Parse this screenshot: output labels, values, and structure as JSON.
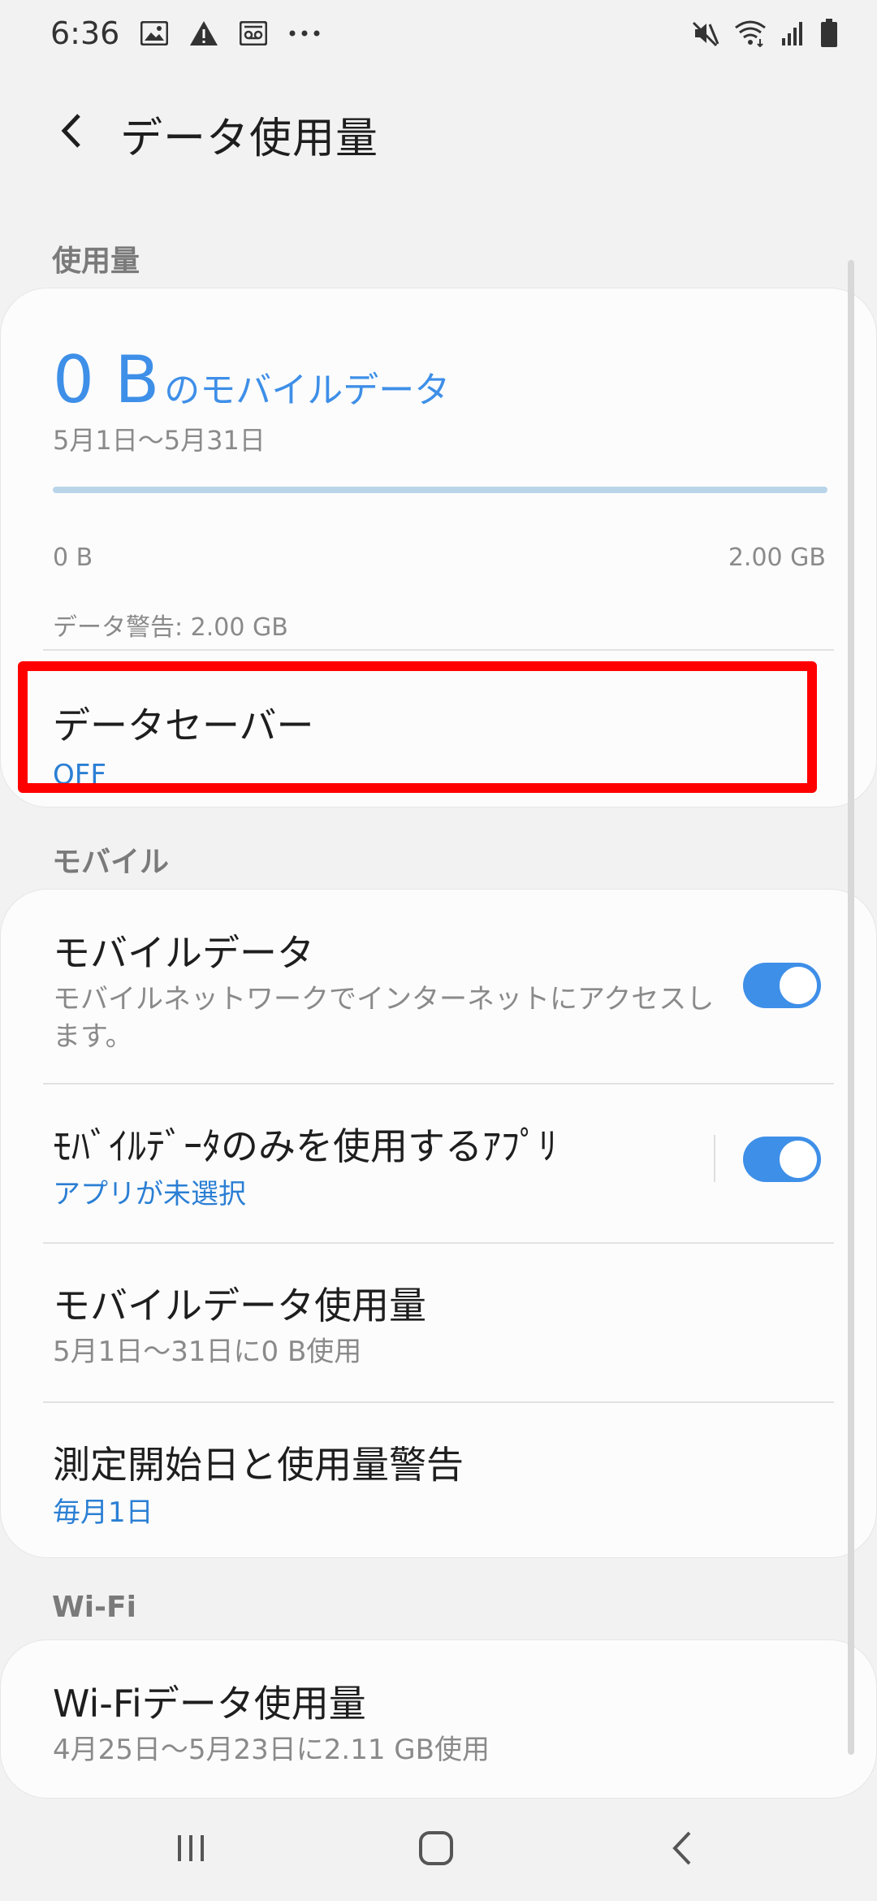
{
  "status_bar": {
    "time": "6:36",
    "left_icons": [
      "image-icon",
      "warning-icon",
      "voicemail-icon",
      "more-icon"
    ],
    "right_icons": [
      "mute-icon",
      "wifi-icon",
      "signal-icon",
      "battery-icon"
    ]
  },
  "header": {
    "title": "データ使用量"
  },
  "sections": {
    "usage": "使用量",
    "mobile": "モバイル",
    "wifi": "Wi-Fi"
  },
  "usage_card": {
    "amount": "0 B",
    "amount_suffix": "のモバイルデータ",
    "period": "5月1日〜5月31日",
    "range_min": "0 B",
    "range_max": "2.00 GB",
    "progress_fraction": 0,
    "warning": "データ警告: 2.00 GB",
    "data_saver_title": "データセーバー",
    "data_saver_status": "OFF"
  },
  "mobile_card": {
    "mobile_data_title": "モバイルデータ",
    "mobile_data_desc": "モバイルネットワークでインターネットにアクセスします。",
    "mobile_data_on": true,
    "mobile_only_title": "ﾓﾊﾞｲﾙﾃﾞｰﾀのみを使用するｱﾌﾟﾘ",
    "mobile_only_sub": "アプリが未選択",
    "mobile_only_on": true,
    "mobile_usage_title": "モバイルデータ使用量",
    "mobile_usage_sub": "5月1日〜31日に0 B使用",
    "billing_title": "測定開始日と使用量警告",
    "billing_sub": "毎月1日"
  },
  "wifi_card": {
    "wifi_usage_title": "Wi-Fiデータ使用量",
    "wifi_usage_sub": "4月25日〜5月23日に2.11 GB使用"
  },
  "colors": {
    "accent": "#3e8fe8",
    "highlight": "#ff0000",
    "background": "#f2f2f2"
  }
}
